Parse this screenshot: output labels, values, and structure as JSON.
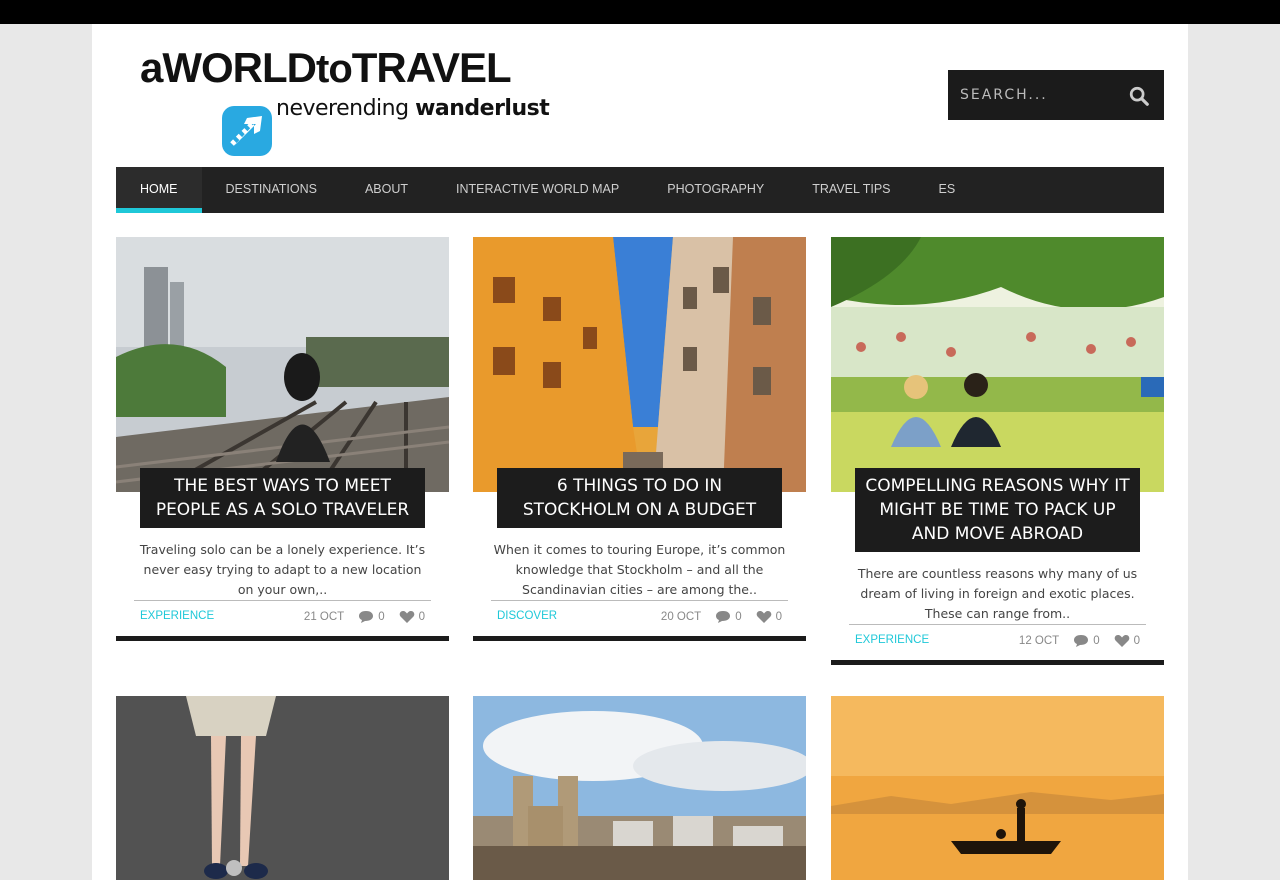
{
  "site": {
    "logo_part1": "aWORLD",
    "logo_part2": "to",
    "logo_part3": "TRAVEL",
    "tagline_part1": "neverending",
    "tagline_part2": "wanderlust"
  },
  "search": {
    "placeholder": "SEARCH...",
    "icon": "search-icon"
  },
  "nav": [
    {
      "label": "HOME",
      "active": true
    },
    {
      "label": "DESTINATIONS"
    },
    {
      "label": "ABOUT"
    },
    {
      "label": "INTERACTIVE WORLD MAP"
    },
    {
      "label": "PHOTOGRAPHY"
    },
    {
      "label": "TRAVEL TIPS"
    },
    {
      "label": "ES"
    }
  ],
  "posts": [
    {
      "title": "THE BEST WAYS TO MEET PEOPLE AS A SOLO TRAVELER",
      "excerpt": "Traveling solo can be a lonely experience. It’s never easy trying to adapt to a new location on your own,..",
      "category": "EXPERIENCE",
      "date": "21 OCT",
      "comments": "0",
      "likes": "0"
    },
    {
      "title": "6 THINGS TO DO IN STOCKHOLM ON A BUDGET",
      "excerpt": "When it comes to touring Europe, it’s common knowledge that Stockholm – and all the Scandinavian cities – are among the..",
      "category": "DISCOVER",
      "date": "20 OCT",
      "comments": "0",
      "likes": "0"
    },
    {
      "title": "COMPELLING REASONS WHY IT MIGHT BE TIME TO PACK UP AND MOVE ABROAD",
      "excerpt": "There are countless reasons why many of us dream of living in foreign and exotic places. These can range from..",
      "category": "EXPERIENCE",
      "date": "12 OCT",
      "comments": "0",
      "likes": "0"
    }
  ],
  "colors": {
    "accent": "#1fc8d8",
    "nav_bg": "#222222",
    "dark": "#1b1b1b"
  }
}
